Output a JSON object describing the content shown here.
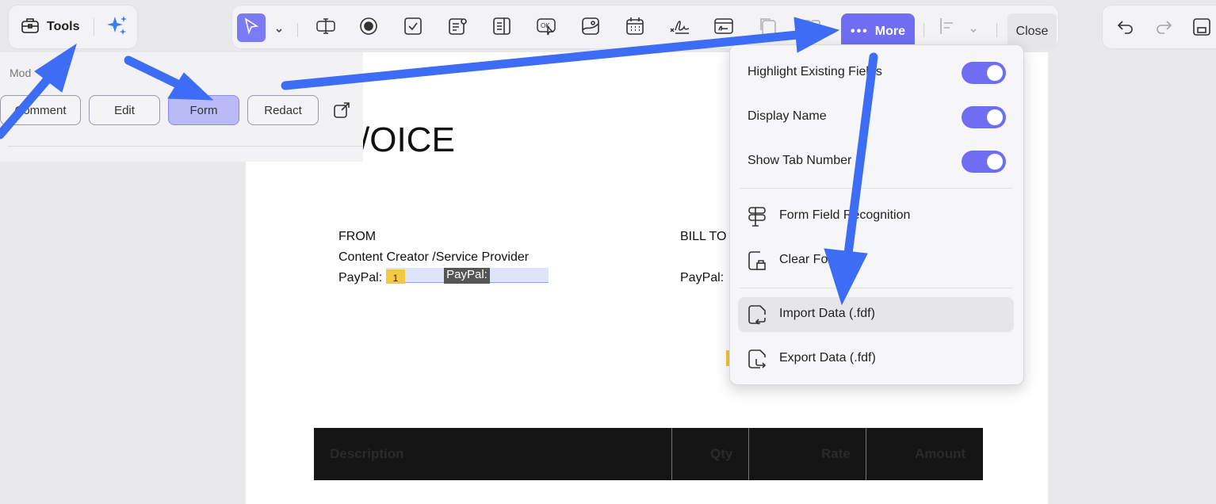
{
  "tools": {
    "label": "Tools"
  },
  "toolbar": {
    "more_label": "More",
    "close_label": "Close",
    "tools": [
      "select-tool",
      "text-field-tool",
      "radio-button-tool",
      "checkbox-tool",
      "dropdown-tool",
      "list-box-tool",
      "button-tool",
      "image-field-tool",
      "date-field-tool",
      "signature-tool",
      "digital-signature-tool",
      "duplicate-tool",
      "align-tool"
    ]
  },
  "modes": {
    "label": "Mod",
    "buttons": [
      "Comment",
      "Edit",
      "Form",
      "Redact"
    ],
    "active": "Form"
  },
  "document": {
    "title_fragment": "/OICE",
    "from_label": "FROM",
    "from_name": "Content Creator /Service Provider",
    "paypal_label": "PayPal:",
    "tab_number": "1",
    "field_name": "PayPal:",
    "bill_to_label": "BILL TO",
    "bill_paypal_label": "PayPal:",
    "table_headers": [
      "Description",
      "Qty",
      "Rate",
      "Amount"
    ]
  },
  "more_menu": {
    "toggles": [
      {
        "label": "Highlight Existing Fields",
        "on": true
      },
      {
        "label": "Display Name",
        "on": true
      },
      {
        "label": "Show Tab Number",
        "on": true
      }
    ],
    "actions": [
      {
        "label": "Form Field Recognition",
        "icon": "form-recognition-icon"
      },
      {
        "label": "Clear Form",
        "icon": "clear-form-icon"
      }
    ],
    "data_actions": [
      {
        "label": "Import Data (.fdf)",
        "icon": "import-data-icon",
        "hovered": true
      },
      {
        "label": "Export Data (.fdf)",
        "icon": "export-data-icon"
      }
    ]
  },
  "colors": {
    "accent": "#6f6df2",
    "annotation_arrow": "#3d6df5",
    "form_active": "#b9baf6"
  }
}
